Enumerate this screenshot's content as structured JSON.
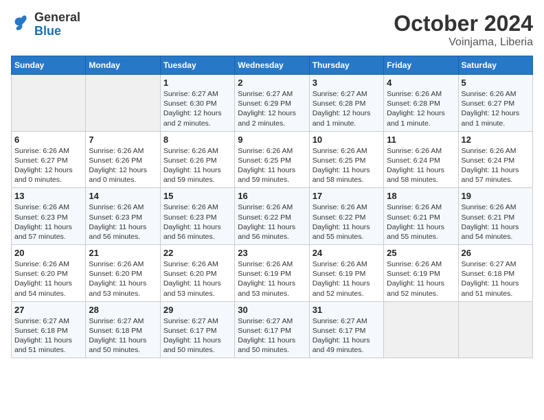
{
  "logo": {
    "text_general": "General",
    "text_blue": "Blue"
  },
  "header": {
    "month": "October 2024",
    "location": "Voinjama, Liberia"
  },
  "weekdays": [
    "Sunday",
    "Monday",
    "Tuesday",
    "Wednesday",
    "Thursday",
    "Friday",
    "Saturday"
  ],
  "weeks": [
    [
      {
        "day": "",
        "sunrise": "",
        "sunset": "",
        "daylight": ""
      },
      {
        "day": "",
        "sunrise": "",
        "sunset": "",
        "daylight": ""
      },
      {
        "day": "1",
        "sunrise": "Sunrise: 6:27 AM",
        "sunset": "Sunset: 6:30 PM",
        "daylight": "Daylight: 12 hours and 2 minutes."
      },
      {
        "day": "2",
        "sunrise": "Sunrise: 6:27 AM",
        "sunset": "Sunset: 6:29 PM",
        "daylight": "Daylight: 12 hours and 2 minutes."
      },
      {
        "day": "3",
        "sunrise": "Sunrise: 6:27 AM",
        "sunset": "Sunset: 6:28 PM",
        "daylight": "Daylight: 12 hours and 1 minute."
      },
      {
        "day": "4",
        "sunrise": "Sunrise: 6:26 AM",
        "sunset": "Sunset: 6:28 PM",
        "daylight": "Daylight: 12 hours and 1 minute."
      },
      {
        "day": "5",
        "sunrise": "Sunrise: 6:26 AM",
        "sunset": "Sunset: 6:27 PM",
        "daylight": "Daylight: 12 hours and 1 minute."
      }
    ],
    [
      {
        "day": "6",
        "sunrise": "Sunrise: 6:26 AM",
        "sunset": "Sunset: 6:27 PM",
        "daylight": "Daylight: 12 hours and 0 minutes."
      },
      {
        "day": "7",
        "sunrise": "Sunrise: 6:26 AM",
        "sunset": "Sunset: 6:26 PM",
        "daylight": "Daylight: 12 hours and 0 minutes."
      },
      {
        "day": "8",
        "sunrise": "Sunrise: 6:26 AM",
        "sunset": "Sunset: 6:26 PM",
        "daylight": "Daylight: 11 hours and 59 minutes."
      },
      {
        "day": "9",
        "sunrise": "Sunrise: 6:26 AM",
        "sunset": "Sunset: 6:25 PM",
        "daylight": "Daylight: 11 hours and 59 minutes."
      },
      {
        "day": "10",
        "sunrise": "Sunrise: 6:26 AM",
        "sunset": "Sunset: 6:25 PM",
        "daylight": "Daylight: 11 hours and 58 minutes."
      },
      {
        "day": "11",
        "sunrise": "Sunrise: 6:26 AM",
        "sunset": "Sunset: 6:24 PM",
        "daylight": "Daylight: 11 hours and 58 minutes."
      },
      {
        "day": "12",
        "sunrise": "Sunrise: 6:26 AM",
        "sunset": "Sunset: 6:24 PM",
        "daylight": "Daylight: 11 hours and 57 minutes."
      }
    ],
    [
      {
        "day": "13",
        "sunrise": "Sunrise: 6:26 AM",
        "sunset": "Sunset: 6:23 PM",
        "daylight": "Daylight: 11 hours and 57 minutes."
      },
      {
        "day": "14",
        "sunrise": "Sunrise: 6:26 AM",
        "sunset": "Sunset: 6:23 PM",
        "daylight": "Daylight: 11 hours and 56 minutes."
      },
      {
        "day": "15",
        "sunrise": "Sunrise: 6:26 AM",
        "sunset": "Sunset: 6:23 PM",
        "daylight": "Daylight: 11 hours and 56 minutes."
      },
      {
        "day": "16",
        "sunrise": "Sunrise: 6:26 AM",
        "sunset": "Sunset: 6:22 PM",
        "daylight": "Daylight: 11 hours and 56 minutes."
      },
      {
        "day": "17",
        "sunrise": "Sunrise: 6:26 AM",
        "sunset": "Sunset: 6:22 PM",
        "daylight": "Daylight: 11 hours and 55 minutes."
      },
      {
        "day": "18",
        "sunrise": "Sunrise: 6:26 AM",
        "sunset": "Sunset: 6:21 PM",
        "daylight": "Daylight: 11 hours and 55 minutes."
      },
      {
        "day": "19",
        "sunrise": "Sunrise: 6:26 AM",
        "sunset": "Sunset: 6:21 PM",
        "daylight": "Daylight: 11 hours and 54 minutes."
      }
    ],
    [
      {
        "day": "20",
        "sunrise": "Sunrise: 6:26 AM",
        "sunset": "Sunset: 6:20 PM",
        "daylight": "Daylight: 11 hours and 54 minutes."
      },
      {
        "day": "21",
        "sunrise": "Sunrise: 6:26 AM",
        "sunset": "Sunset: 6:20 PM",
        "daylight": "Daylight: 11 hours and 53 minutes."
      },
      {
        "day": "22",
        "sunrise": "Sunrise: 6:26 AM",
        "sunset": "Sunset: 6:20 PM",
        "daylight": "Daylight: 11 hours and 53 minutes."
      },
      {
        "day": "23",
        "sunrise": "Sunrise: 6:26 AM",
        "sunset": "Sunset: 6:19 PM",
        "daylight": "Daylight: 11 hours and 53 minutes."
      },
      {
        "day": "24",
        "sunrise": "Sunrise: 6:26 AM",
        "sunset": "Sunset: 6:19 PM",
        "daylight": "Daylight: 11 hours and 52 minutes."
      },
      {
        "day": "25",
        "sunrise": "Sunrise: 6:26 AM",
        "sunset": "Sunset: 6:19 PM",
        "daylight": "Daylight: 11 hours and 52 minutes."
      },
      {
        "day": "26",
        "sunrise": "Sunrise: 6:27 AM",
        "sunset": "Sunset: 6:18 PM",
        "daylight": "Daylight: 11 hours and 51 minutes."
      }
    ],
    [
      {
        "day": "27",
        "sunrise": "Sunrise: 6:27 AM",
        "sunset": "Sunset: 6:18 PM",
        "daylight": "Daylight: 11 hours and 51 minutes."
      },
      {
        "day": "28",
        "sunrise": "Sunrise: 6:27 AM",
        "sunset": "Sunset: 6:18 PM",
        "daylight": "Daylight: 11 hours and 50 minutes."
      },
      {
        "day": "29",
        "sunrise": "Sunrise: 6:27 AM",
        "sunset": "Sunset: 6:17 PM",
        "daylight": "Daylight: 11 hours and 50 minutes."
      },
      {
        "day": "30",
        "sunrise": "Sunrise: 6:27 AM",
        "sunset": "Sunset: 6:17 PM",
        "daylight": "Daylight: 11 hours and 50 minutes."
      },
      {
        "day": "31",
        "sunrise": "Sunrise: 6:27 AM",
        "sunset": "Sunset: 6:17 PM",
        "daylight": "Daylight: 11 hours and 49 minutes."
      },
      {
        "day": "",
        "sunrise": "",
        "sunset": "",
        "daylight": ""
      },
      {
        "day": "",
        "sunrise": "",
        "sunset": "",
        "daylight": ""
      }
    ]
  ]
}
